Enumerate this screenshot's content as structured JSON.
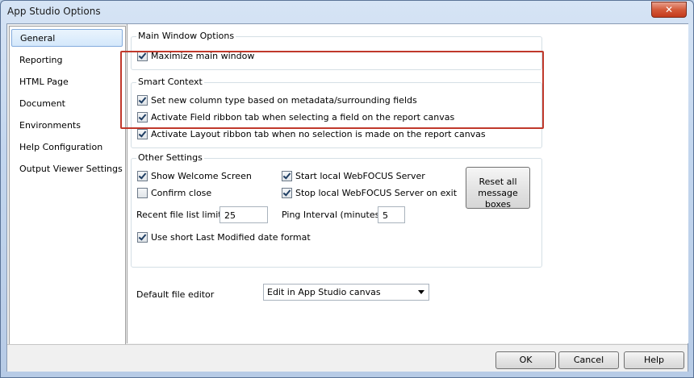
{
  "window": {
    "title": "App Studio Options",
    "close_glyph": "✕"
  },
  "nav": {
    "items": [
      {
        "label": "General"
      },
      {
        "label": "Reporting"
      },
      {
        "label": "HTML Page"
      },
      {
        "label": "Document"
      },
      {
        "label": "Environments"
      },
      {
        "label": "Help Configuration"
      },
      {
        "label": "Output Viewer Settings"
      }
    ],
    "selected": "General"
  },
  "main_window": {
    "group_label": "Main Window Options",
    "maximize": {
      "label": "Maximize main window",
      "checked": true
    }
  },
  "smart_context": {
    "group_label": "Smart Context",
    "items": [
      {
        "label": "Set new column type based on metadata/surrounding fields",
        "checked": true
      },
      {
        "label": "Activate Field ribbon tab when selecting a field on the report canvas",
        "checked": true
      },
      {
        "label": "Activate Layout ribbon tab when no selection is made on the report canvas",
        "checked": true
      }
    ]
  },
  "other": {
    "group_label": "Other Settings",
    "show_welcome": {
      "label": "Show Welcome Screen",
      "checked": true
    },
    "confirm_close": {
      "label": "Confirm close",
      "checked": false
    },
    "start_server": {
      "label": "Start local WebFOCUS Server",
      "checked": true
    },
    "stop_server": {
      "label": "Stop local WebFOCUS Server on exit",
      "checked": true
    },
    "reset_button": {
      "line1": "Reset all",
      "line2": "message boxes"
    },
    "recent_label": "Recent file list limit:",
    "recent_value": "25",
    "ping_label": "Ping Interval (minutes)",
    "ping_value": "5",
    "short_date": {
      "label": "Use short Last Modified date format",
      "checked": true
    }
  },
  "editor": {
    "label": "Default file editor",
    "value": "Edit in App Studio canvas"
  },
  "buttons": {
    "ok": "OK",
    "cancel": "Cancel",
    "help": "Help"
  },
  "colors": {
    "highlight": "#c0392b",
    "selection": "#d4e8fb"
  }
}
